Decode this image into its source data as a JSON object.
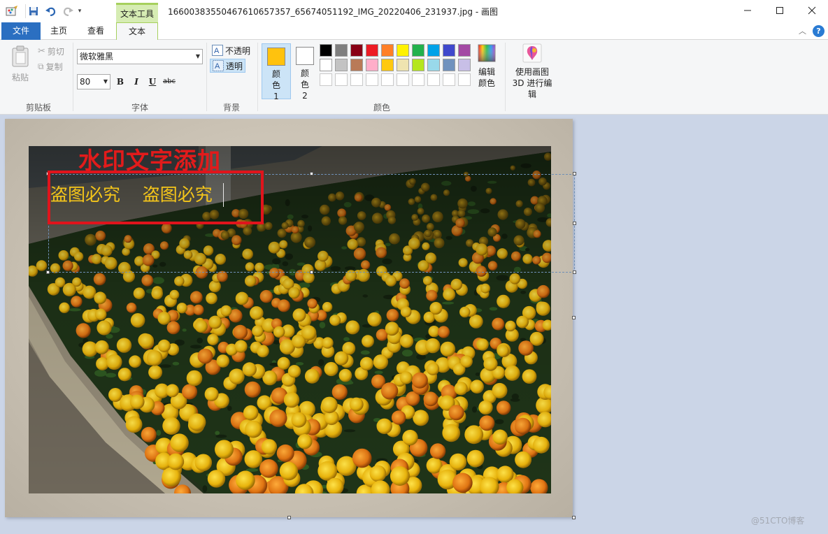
{
  "window": {
    "title": "16600383550467610657357_65674051192_IMG_20220406_231937.jpg - 画图",
    "context_tab": "文本工具"
  },
  "tabs": [
    "文件",
    "主页",
    "查看",
    "文本"
  ],
  "clipboard": {
    "paste": "粘贴",
    "cut": "剪切",
    "copy": "复制",
    "group": "剪贴板"
  },
  "font": {
    "name": "微软雅黑",
    "size": "80",
    "bold": "B",
    "italic": "I",
    "underline": "U",
    "strike": "abc",
    "group": "字体"
  },
  "background": {
    "opaque": "不透明",
    "transparent": "透明",
    "group": "背景",
    "selected": "transparent"
  },
  "colors": {
    "color1_label": "颜色 1",
    "color2_label": "颜色 2",
    "color1": "#ffc20e",
    "color2": "#ffffff",
    "edit_colors": "编辑颜色",
    "paint3d": "使用画图 3D 进行编辑",
    "group": "颜色",
    "palette_row1": [
      "#000000",
      "#7f7f7f",
      "#880015",
      "#ed1c24",
      "#ff7f27",
      "#fff200",
      "#22b14c",
      "#00a2e8",
      "#3f48cc",
      "#a349a4"
    ],
    "palette_row2": [
      "#ffffff",
      "#c3c3c3",
      "#b97a57",
      "#ffaec9",
      "#ffc90e",
      "#efe4b0",
      "#b5e61d",
      "#99d9ea",
      "#7092be",
      "#c8bfe7"
    ],
    "palette_row3": [
      "#ffffff",
      "#ffffff",
      "#ffffff",
      "#ffffff",
      "#ffffff",
      "#ffffff",
      "#ffffff",
      "#ffffff",
      "#ffffff",
      "#ffffff"
    ]
  },
  "canvas": {
    "watermark_title": "水印文字添加",
    "text_content": "盗图必究    盗图必究"
  },
  "credit": "@51CTO博客"
}
